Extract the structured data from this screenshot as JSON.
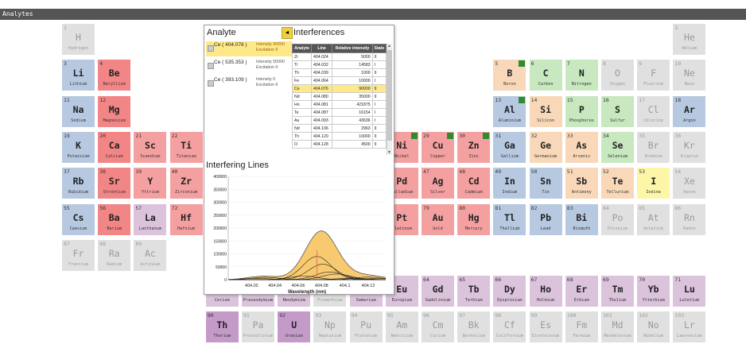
{
  "window": {
    "title": "Analytes"
  },
  "elements": [
    {
      "n": "1",
      "s": "H",
      "name": "Hydrogen",
      "c": "g",
      "col": 1,
      "row": 1
    },
    {
      "n": "2",
      "s": "He",
      "name": "Helium",
      "c": "g",
      "col": 18,
      "row": 1
    },
    {
      "n": "3",
      "s": "Li",
      "name": "Lithium",
      "c": "blue",
      "col": 1,
      "row": 2
    },
    {
      "n": "4",
      "s": "Be",
      "name": "Beryllium",
      "c": "red",
      "col": 2,
      "row": 2
    },
    {
      "n": "5",
      "s": "B",
      "name": "Boron",
      "c": "orange",
      "col": 13,
      "row": 2,
      "m": true
    },
    {
      "n": "6",
      "s": "C",
      "name": "Carbon",
      "c": "green",
      "col": 14,
      "row": 2
    },
    {
      "n": "7",
      "s": "N",
      "name": "Nitrogen",
      "c": "green",
      "col": 15,
      "row": 2
    },
    {
      "n": "8",
      "s": "O",
      "name": "Oxygen",
      "c": "g",
      "col": 16,
      "row": 2
    },
    {
      "n": "9",
      "s": "F",
      "name": "Fluorine",
      "c": "g",
      "col": 17,
      "row": 2
    },
    {
      "n": "10",
      "s": "Ne",
      "name": "Neon",
      "c": "g",
      "col": 18,
      "row": 2
    },
    {
      "n": "11",
      "s": "Na",
      "name": "Sodium",
      "c": "blue",
      "col": 1,
      "row": 3
    },
    {
      "n": "12",
      "s": "Mg",
      "name": "Magnesium",
      "c": "red",
      "col": 2,
      "row": 3
    },
    {
      "n": "13",
      "s": "Al",
      "name": "Aluminium",
      "c": "blue",
      "col": 13,
      "row": 3,
      "m": true
    },
    {
      "n": "14",
      "s": "Si",
      "name": "Silicon",
      "c": "orange",
      "col": 14,
      "row": 3
    },
    {
      "n": "15",
      "s": "P",
      "name": "Phosphorus",
      "c": "green",
      "col": 15,
      "row": 3
    },
    {
      "n": "16",
      "s": "S",
      "name": "Sulfur",
      "c": "green",
      "col": 16,
      "row": 3
    },
    {
      "n": "17",
      "s": "Cl",
      "name": "Chlorine",
      "c": "g",
      "col": 17,
      "row": 3
    },
    {
      "n": "18",
      "s": "Ar",
      "name": "Argon",
      "c": "blue",
      "col": 18,
      "row": 3
    },
    {
      "n": "19",
      "s": "K",
      "name": "Potassium",
      "c": "blue",
      "col": 1,
      "row": 4
    },
    {
      "n": "20",
      "s": "Ca",
      "name": "Calcium",
      "c": "red",
      "col": 2,
      "row": 4
    },
    {
      "n": "21",
      "s": "Sc",
      "name": "Scandium",
      "c": "pink",
      "col": 3,
      "row": 4
    },
    {
      "n": "22",
      "s": "Ti",
      "name": "Titanium",
      "c": "pink",
      "col": 4,
      "row": 4
    },
    {
      "n": "28",
      "s": "Ni",
      "name": "Nickel",
      "c": "pink",
      "col": 10,
      "row": 4,
      "m": true
    },
    {
      "n": "29",
      "s": "Cu",
      "name": "Copper",
      "c": "pink",
      "col": 11,
      "row": 4,
      "m": true
    },
    {
      "n": "30",
      "s": "Zn",
      "name": "Zinc",
      "c": "pink",
      "col": 12,
      "row": 4,
      "m": true
    },
    {
      "n": "31",
      "s": "Ga",
      "name": "Gallium",
      "c": "blue",
      "col": 13,
      "row": 4
    },
    {
      "n": "32",
      "s": "Ge",
      "name": "Germanium",
      "c": "orange",
      "col": 14,
      "row": 4
    },
    {
      "n": "33",
      "s": "As",
      "name": "Arsenic",
      "c": "orange",
      "col": 15,
      "row": 4
    },
    {
      "n": "34",
      "s": "Se",
      "name": "Selenium",
      "c": "green",
      "col": 16,
      "row": 4
    },
    {
      "n": "35",
      "s": "Br",
      "name": "Bromine",
      "c": "g",
      "col": 17,
      "row": 4
    },
    {
      "n": "36",
      "s": "Kr",
      "name": "Krypton",
      "c": "g",
      "col": 18,
      "row": 4
    },
    {
      "n": "37",
      "s": "Rb",
      "name": "Rubidium",
      "c": "blue",
      "col": 1,
      "row": 5
    },
    {
      "n": "38",
      "s": "Sr",
      "name": "Strontium",
      "c": "red",
      "col": 2,
      "row": 5
    },
    {
      "n": "39",
      "s": "Y",
      "name": "Yttrium",
      "c": "pink",
      "col": 3,
      "row": 5
    },
    {
      "n": "40",
      "s": "Zr",
      "name": "Zirconium",
      "c": "pink",
      "col": 4,
      "row": 5
    },
    {
      "n": "46",
      "s": "Pd",
      "name": "Palladium",
      "c": "pink",
      "col": 10,
      "row": 5
    },
    {
      "n": "47",
      "s": "Ag",
      "name": "Silver",
      "c": "pink",
      "col": 11,
      "row": 5
    },
    {
      "n": "48",
      "s": "Cd",
      "name": "Cadmium",
      "c": "pink",
      "col": 12,
      "row": 5
    },
    {
      "n": "49",
      "s": "In",
      "name": "Indium",
      "c": "blue",
      "col": 13,
      "row": 5
    },
    {
      "n": "50",
      "s": "Sn",
      "name": "Tin",
      "c": "blue",
      "col": 14,
      "row": 5
    },
    {
      "n": "51",
      "s": "Sb",
      "name": "Antimony",
      "c": "orange",
      "col": 15,
      "row": 5
    },
    {
      "n": "52",
      "s": "Te",
      "name": "Tellurium",
      "c": "orange",
      "col": 16,
      "row": 5
    },
    {
      "n": "53",
      "s": "I",
      "name": "Iodine",
      "c": "yellow",
      "col": 17,
      "row": 5
    },
    {
      "n": "54",
      "s": "Xe",
      "name": "Xenon",
      "c": "g",
      "col": 18,
      "row": 5
    },
    {
      "n": "55",
      "s": "Cs",
      "name": "Caesium",
      "c": "blue",
      "col": 1,
      "row": 6
    },
    {
      "n": "56",
      "s": "Ba",
      "name": "Barium",
      "c": "red",
      "col": 2,
      "row": 6
    },
    {
      "n": "57",
      "s": "La",
      "name": "Lanthanum",
      "c": "lav",
      "col": 3,
      "row": 6
    },
    {
      "n": "72",
      "s": "Hf",
      "name": "Hafnium",
      "c": "pink",
      "col": 4,
      "row": 6
    },
    {
      "n": "78",
      "s": "Pt",
      "name": "Platinum",
      "c": "pink",
      "col": 10,
      "row": 6
    },
    {
      "n": "79",
      "s": "Au",
      "name": "Gold",
      "c": "pink",
      "col": 11,
      "row": 6
    },
    {
      "n": "80",
      "s": "Hg",
      "name": "Mercury",
      "c": "pink",
      "col": 12,
      "row": 6
    },
    {
      "n": "81",
      "s": "Tl",
      "name": "Thallium",
      "c": "blue",
      "col": 13,
      "row": 6
    },
    {
      "n": "82",
      "s": "Pb",
      "name": "Lead",
      "c": "blue",
      "col": 14,
      "row": 6
    },
    {
      "n": "83",
      "s": "Bi",
      "name": "Bismuth",
      "c": "blue",
      "col": 15,
      "row": 6
    },
    {
      "n": "84",
      "s": "Po",
      "name": "Polonium",
      "c": "g",
      "col": 16,
      "row": 6
    },
    {
      "n": "85",
      "s": "At",
      "name": "Astatine",
      "c": "g",
      "col": 17,
      "row": 6
    },
    {
      "n": "86",
      "s": "Rn",
      "name": "Radon",
      "c": "g",
      "col": 18,
      "row": 6
    },
    {
      "n": "87",
      "s": "Fr",
      "name": "Francium",
      "c": "g",
      "col": 1,
      "row": 7
    },
    {
      "n": "88",
      "s": "Ra",
      "name": "Radium",
      "c": "g",
      "col": 2,
      "row": 7
    },
    {
      "n": "89",
      "s": "Ac",
      "name": "Actinium",
      "c": "g",
      "col": 3,
      "row": 7
    },
    {
      "n": "58",
      "s": "Ce",
      "name": "Cerium",
      "c": "lav",
      "col": 5,
      "row": 8,
      "m": true
    },
    {
      "n": "59",
      "s": "Pr",
      "name": "Praseodymium",
      "c": "lav",
      "col": 6,
      "row": 8
    },
    {
      "n": "60",
      "s": "Nd",
      "name": "Neodymium",
      "c": "lav",
      "col": 7,
      "row": 8
    },
    {
      "n": "61",
      "s": "Pm",
      "name": "Promethium",
      "c": "g",
      "col": 8,
      "row": 8
    },
    {
      "n": "62",
      "s": "Sm",
      "name": "Samarium",
      "c": "lav",
      "col": 9,
      "row": 8
    },
    {
      "n": "63",
      "s": "Eu",
      "name": "Europium",
      "c": "lav",
      "col": 10,
      "row": 8
    },
    {
      "n": "64",
      "s": "Gd",
      "name": "Gadolinium",
      "c": "lav",
      "col": 11,
      "row": 8
    },
    {
      "n": "65",
      "s": "Tb",
      "name": "Terbium",
      "c": "lav",
      "col": 12,
      "row": 8
    },
    {
      "n": "66",
      "s": "Dy",
      "name": "Dysprosium",
      "c": "lav",
      "col": 13,
      "row": 8
    },
    {
      "n": "67",
      "s": "Ho",
      "name": "Holmium",
      "c": "lav",
      "col": 14,
      "row": 8
    },
    {
      "n": "68",
      "s": "Er",
      "name": "Erbium",
      "c": "lav",
      "col": 15,
      "row": 8
    },
    {
      "n": "69",
      "s": "Tm",
      "name": "Thulium",
      "c": "lav",
      "col": 16,
      "row": 8
    },
    {
      "n": "70",
      "s": "Yb",
      "name": "Ytterbium",
      "c": "lav",
      "col": 17,
      "row": 8
    },
    {
      "n": "71",
      "s": "Lu",
      "name": "Lutetium",
      "c": "lav",
      "col": 18,
      "row": 8
    },
    {
      "n": "90",
      "s": "Th",
      "name": "Thorium",
      "c": "purple",
      "col": 5,
      "row": 9
    },
    {
      "n": "91",
      "s": "Pa",
      "name": "Protactinium",
      "c": "g",
      "col": 6,
      "row": 9
    },
    {
      "n": "92",
      "s": "U",
      "name": "Uranium",
      "c": "purple",
      "col": 7,
      "row": 9
    },
    {
      "n": "93",
      "s": "Np",
      "name": "Neptunium",
      "c": "g",
      "col": 8,
      "row": 9
    },
    {
      "n": "94",
      "s": "Pu",
      "name": "Plutonium",
      "c": "g",
      "col": 9,
      "row": 9
    },
    {
      "n": "95",
      "s": "Am",
      "name": "Americium",
      "c": "g",
      "col": 10,
      "row": 9
    },
    {
      "n": "96",
      "s": "Cm",
      "name": "Curium",
      "c": "g",
      "col": 11,
      "row": 9
    },
    {
      "n": "97",
      "s": "Bk",
      "name": "Berkelium",
      "c": "g",
      "col": 12,
      "row": 9
    },
    {
      "n": "98",
      "s": "Cf",
      "name": "Californium",
      "c": "g",
      "col": 13,
      "row": 9
    },
    {
      "n": "99",
      "s": "Es",
      "name": "Einsteinium",
      "c": "g",
      "col": 14,
      "row": 9
    },
    {
      "n": "100",
      "s": "Fm",
      "name": "Fermium",
      "c": "g",
      "col": 15,
      "row": 9
    },
    {
      "n": "101",
      "s": "Md",
      "name": "Mendelevium",
      "c": "g",
      "col": 16,
      "row": 9
    },
    {
      "n": "102",
      "s": "No",
      "name": "Nobelium",
      "c": "g",
      "col": 17,
      "row": 9
    },
    {
      "n": "103",
      "s": "Lr",
      "name": "Lawrencium",
      "c": "g",
      "col": 18,
      "row": 9
    }
  ],
  "panel": {
    "analyte_title": "Analyte",
    "collapse_icon": "◄",
    "interferences_title": "Interferences",
    "analytes": [
      {
        "label": "Ce ( 404.076 )",
        "intensity": "Intensity  90000",
        "excitation": "Excitation II",
        "selected": true
      },
      {
        "label": "Ce ( 535.353 )",
        "intensity": "Intensity  50000",
        "excitation": "Excitation II",
        "selected": false
      },
      {
        "label": "Ce ( 393.109 )",
        "intensity": "Intensity  0",
        "excitation": "Excitation II",
        "selected": false
      }
    ],
    "table": {
      "headers": [
        "Analyte",
        "Line",
        "Relative intensity",
        "State"
      ],
      "rows": [
        [
          "Zr",
          "404.024",
          "5000",
          "II"
        ],
        [
          "Ti",
          "404.032",
          "14583",
          "I"
        ],
        [
          "Th",
          "404.039",
          "1000",
          "II"
        ],
        [
          "Fe",
          "404.064",
          "10000",
          "I"
        ],
        [
          "Ce",
          "404.076",
          "90000",
          "II"
        ],
        [
          "Nd",
          "404.080",
          "35000",
          "II"
        ],
        [
          "Ho",
          "404.081",
          "421875",
          "I"
        ],
        [
          "Te",
          "404.087",
          "16154",
          "I"
        ],
        [
          "Au",
          "404.093",
          "43636",
          "I"
        ],
        [
          "Nd",
          "404.106",
          "2963",
          "II"
        ],
        [
          "Th",
          "404.120",
          "10000",
          "II"
        ],
        [
          "O",
          "404.128",
          "4500",
          "II"
        ]
      ],
      "selected_row": 4
    },
    "chart_title": "Interfering Lines"
  },
  "chart_data": {
    "type": "line",
    "title": "Interfering Lines",
    "xlabel": "Wavelength (nm)",
    "ylabel": "",
    "xlim": [
      404.0,
      404.135
    ],
    "ylim": [
      0,
      400000
    ],
    "x_ticks": [
      "404.02",
      "404.04",
      "404.06",
      "404.08",
      "404.1",
      "404.12"
    ],
    "y_ticks": [
      "0",
      "50000",
      "100000",
      "150000",
      "200000",
      "250000",
      "300000",
      "350000",
      "400000"
    ],
    "analyte_line": {
      "x": 404.076,
      "y": 90000,
      "color": "#e06060"
    },
    "analyte_fill_color": "#f5b840",
    "series": [
      {
        "center": 404.076,
        "peak": 90000
      },
      {
        "center": 404.081,
        "peak": 60000
      },
      {
        "center": 404.087,
        "peak": 30000
      },
      {
        "center": 404.093,
        "peak": 22000
      },
      {
        "center": 404.064,
        "peak": 14000
      },
      {
        "center": 404.032,
        "peak": 9000
      },
      {
        "center": 404.024,
        "peak": 5000
      },
      {
        "center": 404.12,
        "peak": 10000
      },
      {
        "center": 404.106,
        "peak": 6000
      },
      {
        "center": 404.128,
        "peak": 4500
      }
    ]
  }
}
